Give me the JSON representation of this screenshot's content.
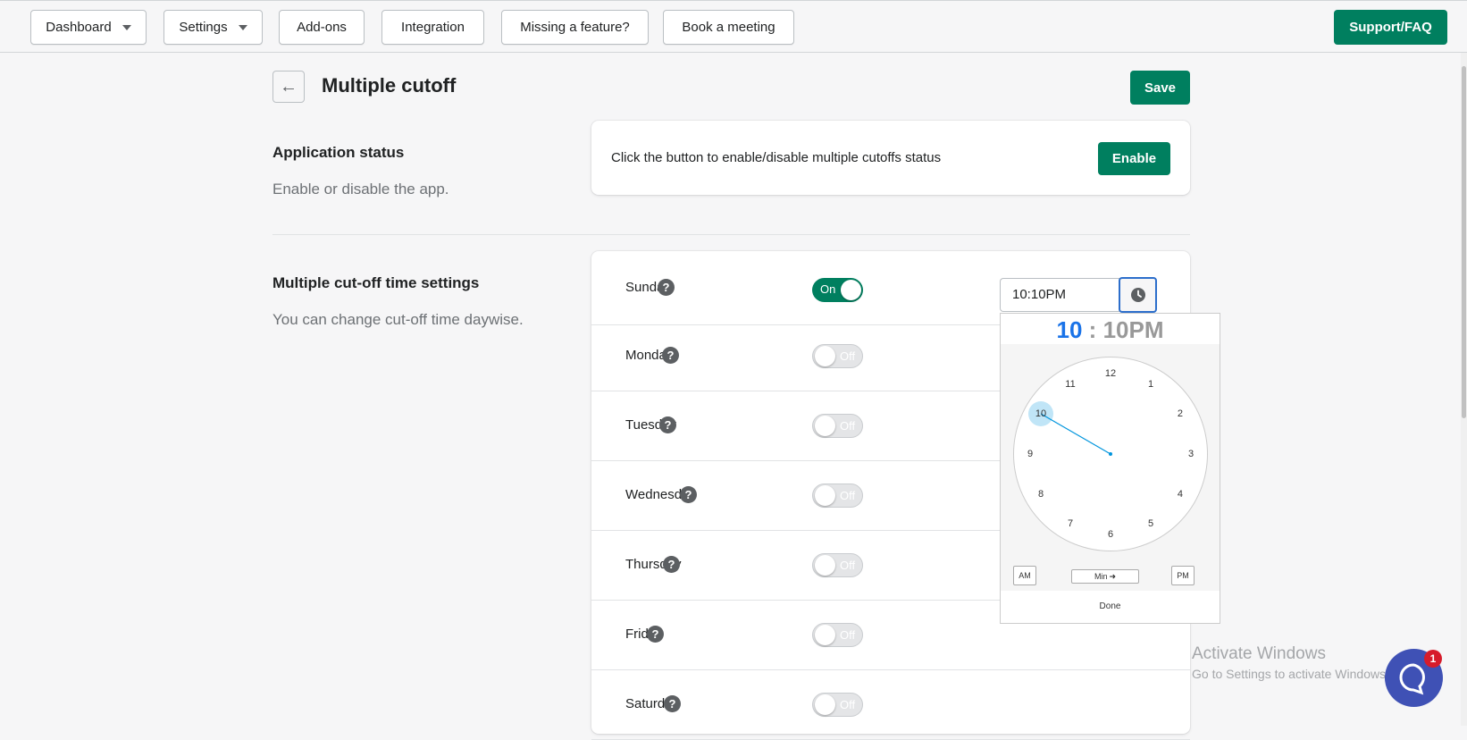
{
  "nav": {
    "dashboard": "Dashboard",
    "settings": "Settings",
    "addons": "Add-ons",
    "integration": "Integration",
    "missing_feature": "Missing a feature?",
    "book_meeting": "Book a meeting",
    "support": "Support/FAQ"
  },
  "page": {
    "title": "Multiple cutoff",
    "save": "Save"
  },
  "app_status": {
    "title": "Application status",
    "desc": "Enable or disable the app.",
    "card_text": "Click the button to enable/disable multiple cutoffs status",
    "enable": "Enable"
  },
  "cutoff": {
    "title": "Multiple cut-off time settings",
    "desc": "You can change cut-off time daywise.",
    "help_glyph": "?",
    "days": [
      {
        "name": "Sunday",
        "toggle": "On",
        "enabled": true
      },
      {
        "name": "Monday",
        "toggle": "Off",
        "enabled": false
      },
      {
        "name": "Tuesday",
        "toggle": "Off",
        "enabled": false
      },
      {
        "name": "Wednesday",
        "toggle": "Off",
        "enabled": false
      },
      {
        "name": "Thursday",
        "toggle": "Off",
        "enabled": false
      },
      {
        "name": "Friday",
        "toggle": "Off",
        "enabled": false
      },
      {
        "name": "Saturday",
        "toggle": "Off",
        "enabled": false
      }
    ],
    "sunday_time": "10:10PM"
  },
  "clock_picker": {
    "hour": "10",
    "sep": ":",
    "minute_period": "10PM",
    "numbers": [
      "12",
      "1",
      "2",
      "3",
      "4",
      "5",
      "6",
      "7",
      "8",
      "9",
      "10",
      "11"
    ],
    "selected_hour": 10,
    "am": "AM",
    "pm": "PM",
    "min": "Min",
    "done": "Done"
  },
  "watermark": {
    "line1": "Activate Windows",
    "line2": "Go to Settings to activate Windows."
  },
  "chat": {
    "badge": "1"
  },
  "colors": {
    "primary": "#007f5f",
    "focus": "#2c6ecb",
    "clock_accent": "#1a73e8",
    "chat": "#3f51b5"
  }
}
